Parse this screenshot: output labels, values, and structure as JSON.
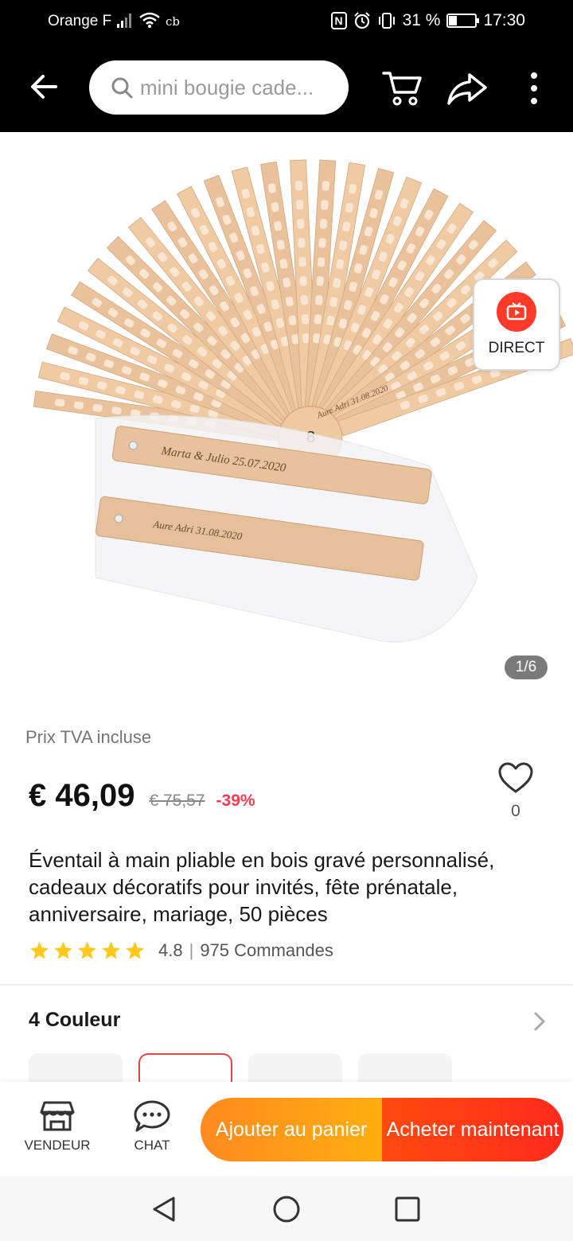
{
  "status_bar": {
    "carrier": "Orange F",
    "cb": "cb",
    "battery": "31 %",
    "time": "17:30",
    "battery_level": 0.31
  },
  "search": {
    "placeholder": "mini bougie cade..."
  },
  "product_image": {
    "direct_label": "DIRECT",
    "pager": "1/6",
    "engraving_1": "Marta & Julio 25.07.2020",
    "engraving_2": "Aure Adri 31.08.2020",
    "engraving_3": "Aure Adri 31.08.2020",
    "fan_number": "8"
  },
  "pricing": {
    "tax_note": "Prix TVA incluse",
    "price": "€ 46,09",
    "old_price": "€ 75,57",
    "discount": "-39%"
  },
  "wishlist": {
    "count": "0"
  },
  "product": {
    "title": "Éventail à main pliable en bois gravé personnalisé, cadeaux décoratifs pour invités, fête prénatale, anniversaire, mariage, 50 pièces"
  },
  "rating": {
    "value": "4.8",
    "separator": "|",
    "orders": "975 Commandes",
    "stars": 5
  },
  "colors": {
    "title": "4 Couleur"
  },
  "actions": {
    "store": "VENDEUR",
    "chat": "CHAT",
    "add_to_cart": "Ajouter au panier",
    "buy_now": "Acheter maintenant"
  },
  "theme": {
    "accent_red": "#fd384f",
    "cart_orange": "#ff9a16",
    "buy_red": "#ff3a16",
    "star_yellow": "#ffc81e"
  }
}
